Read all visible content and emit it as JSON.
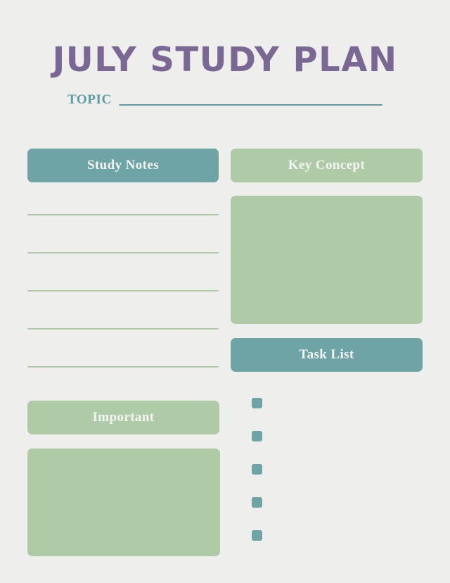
{
  "document": {
    "title": "JULY STUDY PLAN",
    "background_color": "#eeeeed"
  },
  "topic": {
    "label": "TOPIC",
    "value": "",
    "placeholder": "",
    "line_color": "#5f9ba1"
  },
  "colors": {
    "purple": "#7b6794",
    "teal": "#6fa4a6",
    "sage": "#aecaa7",
    "teal_text": "#5f9ba1",
    "header_text": "#f4f4f2"
  },
  "sections": {
    "study_notes": {
      "header": "Study Notes",
      "header_color": "#6fa4a6",
      "line_count": 5,
      "lines": [
        "",
        "",
        "",
        "",
        ""
      ]
    },
    "key_concept": {
      "header": "Key Concept",
      "header_color": "#aecaa7",
      "body": "",
      "body_color": "#aecaa7"
    },
    "task_list": {
      "header": "Task List",
      "header_color": "#6fa4a6",
      "items": [
        {
          "label": "",
          "checked": false
        },
        {
          "label": "",
          "checked": false
        },
        {
          "label": "",
          "checked": false
        },
        {
          "label": "",
          "checked": false
        },
        {
          "label": "",
          "checked": false
        }
      ]
    },
    "important": {
      "header": "Important",
      "header_color": "#aecaa7",
      "body": "",
      "body_color": "#aecaa7"
    }
  }
}
